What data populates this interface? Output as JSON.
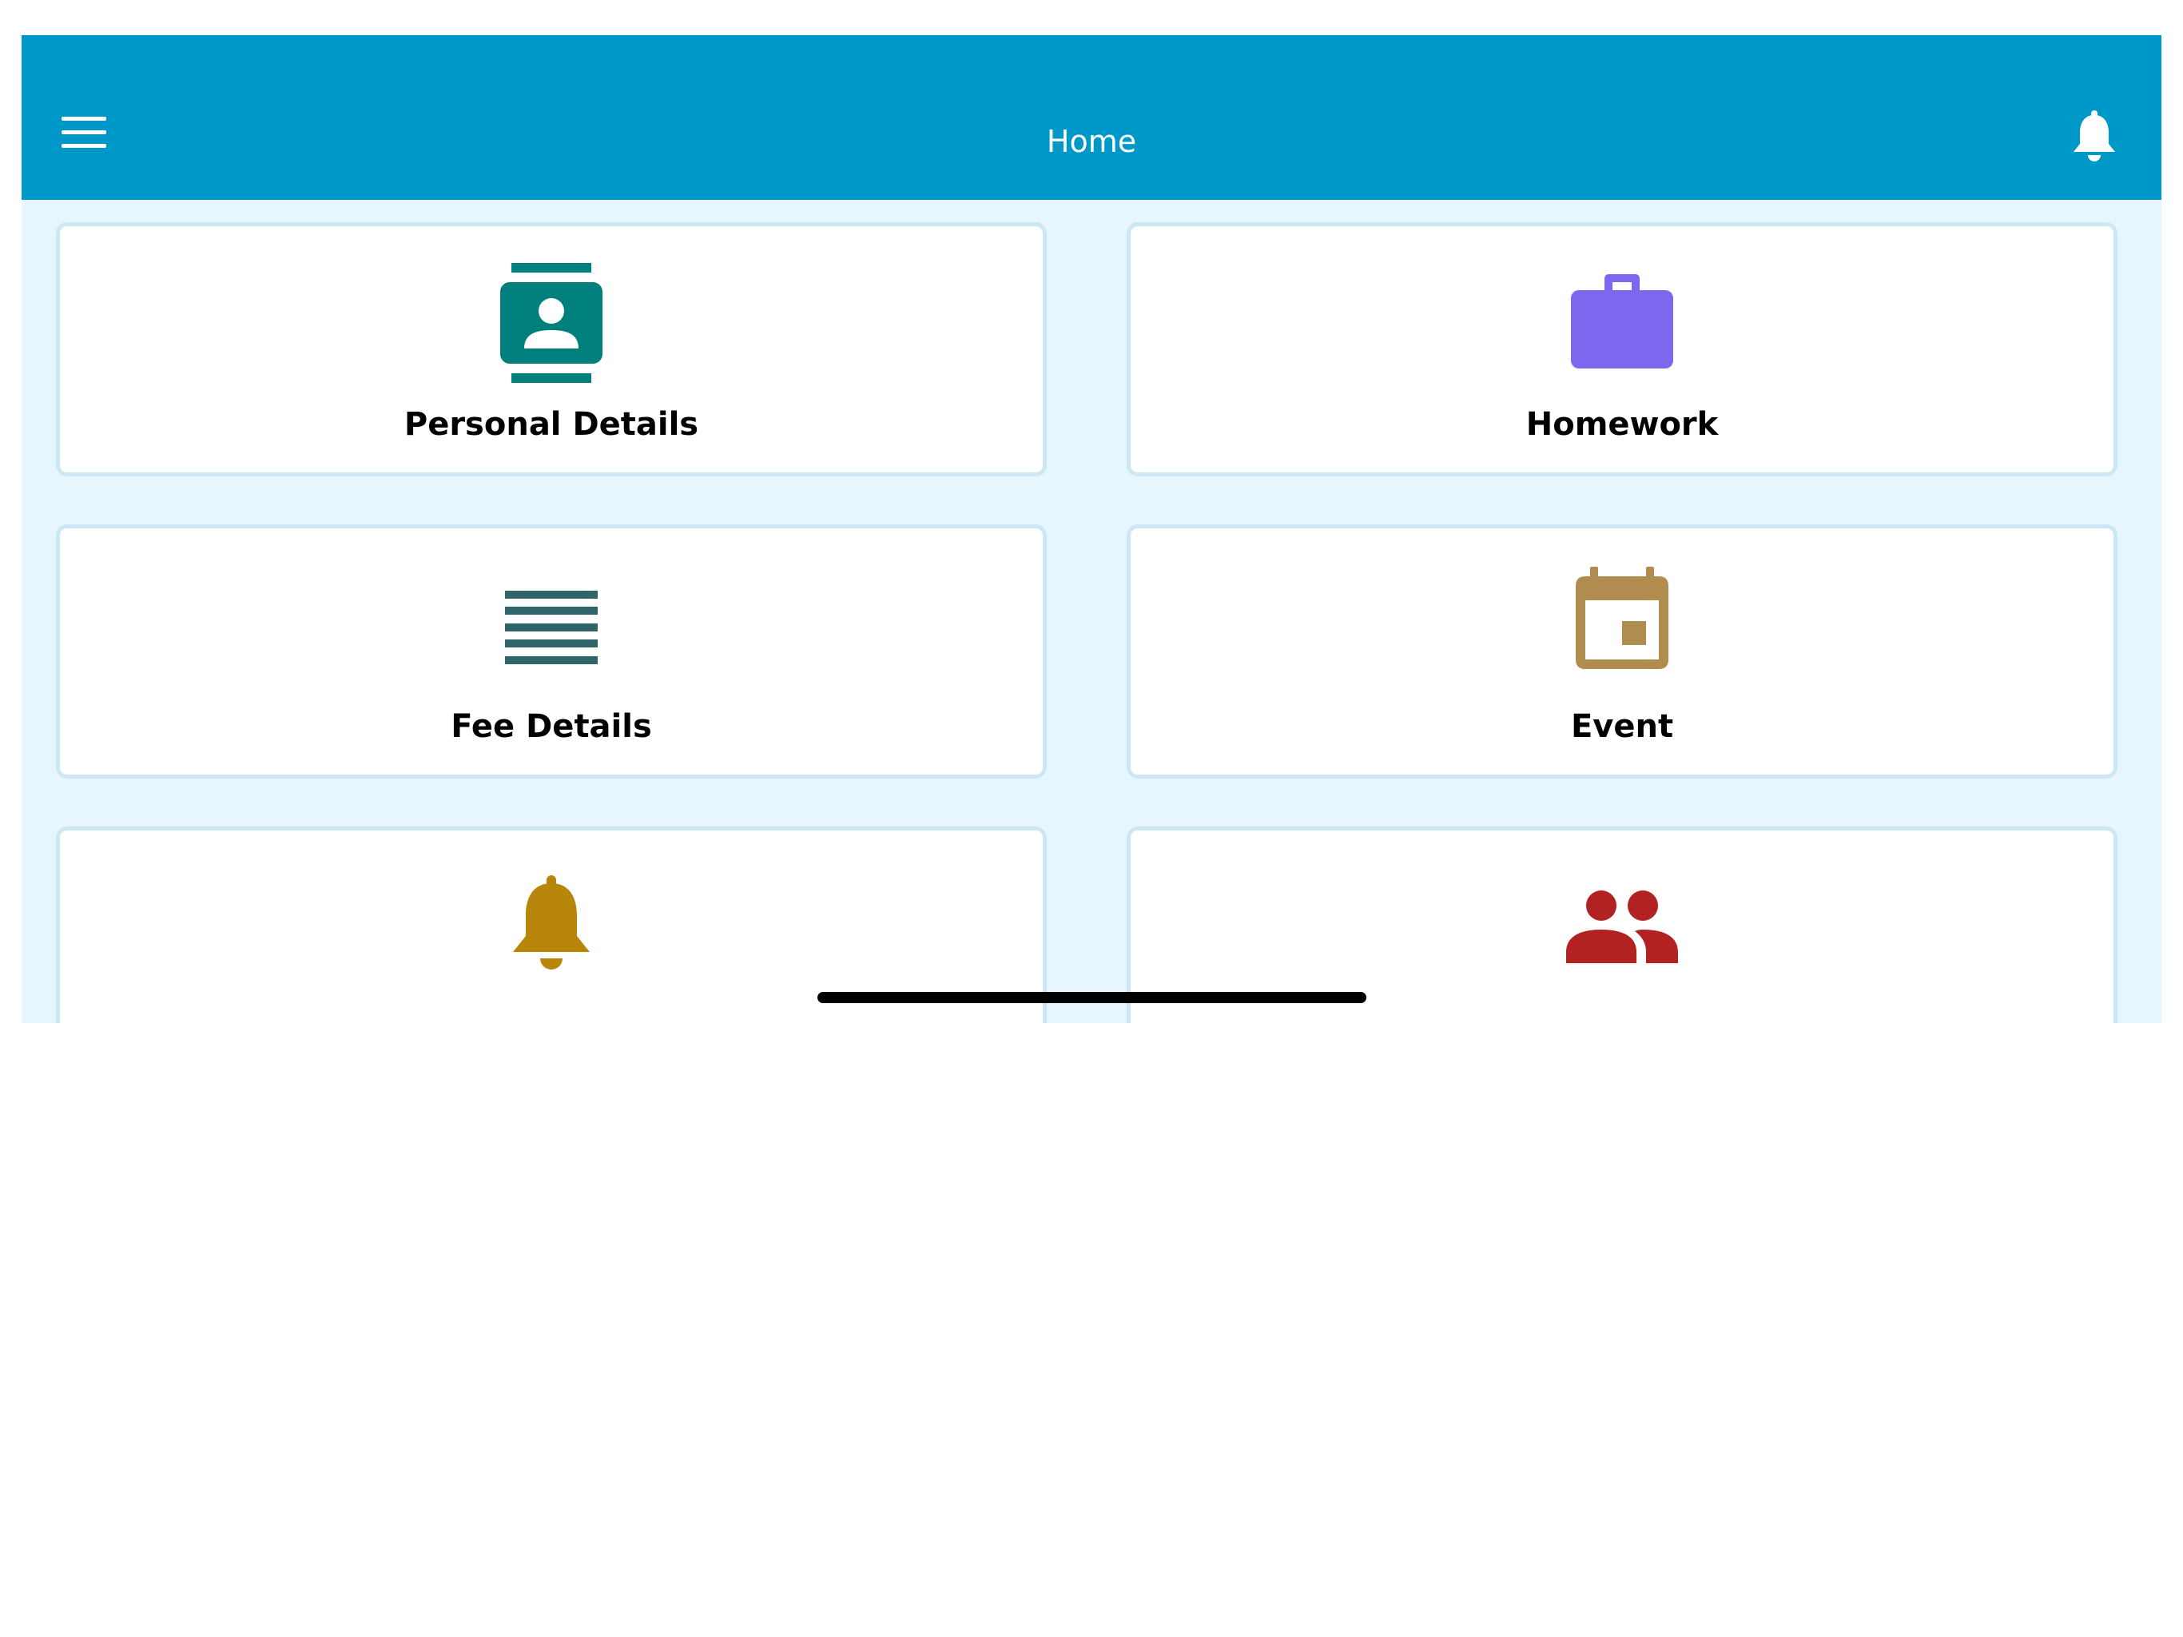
{
  "header": {
    "title": "Home",
    "background": "#0098c9",
    "menu_icon": "hamburger-menu-icon",
    "notification_icon": "bell-icon"
  },
  "tiles": [
    {
      "label": "Personal Details",
      "icon": "contact-book-icon",
      "color": "#00807c"
    },
    {
      "label": "Homework",
      "icon": "briefcase-icon",
      "color": "#7b68ee"
    },
    {
      "label": "Fee Details",
      "icon": "list-lines-icon",
      "color": "#2f6468"
    },
    {
      "label": "Event",
      "icon": "calendar-icon",
      "color": "#b08d4e"
    },
    {
      "label": "",
      "icon": "bell-icon",
      "color": "#b8860b"
    },
    {
      "label": "",
      "icon": "group-people-icon",
      "color": "#b22222"
    }
  ],
  "colors": {
    "content_background": "#e7f5fc",
    "card_border": "#cce8f5"
  }
}
